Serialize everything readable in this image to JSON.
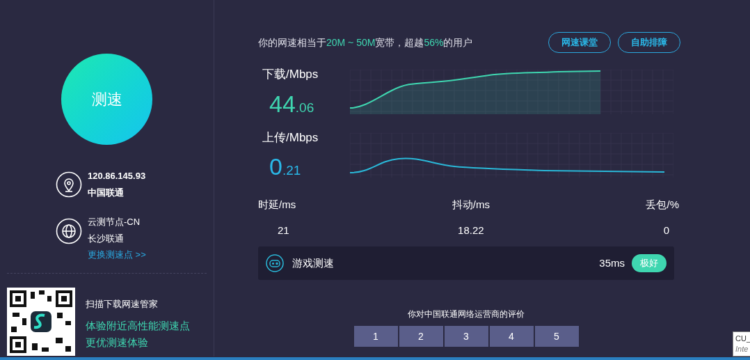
{
  "speed_button": {
    "label": "测速"
  },
  "connection": {
    "ip": "120.86.145.93",
    "isp": "中国联通"
  },
  "node": {
    "name": "云测节点-CN",
    "location": "长沙联通",
    "change_link": "更换测速点 >>"
  },
  "promo": {
    "title": "扫描下载网速管家",
    "lines": [
      "体验附近高性能测速点",
      "更优测速体验"
    ]
  },
  "summary": [
    {
      "text": "你的网速相当于",
      "highlight": false
    },
    {
      "text": "20M ~ 50M",
      "highlight": true
    },
    {
      "text": "宽带，超越",
      "highlight": false
    },
    {
      "text": "56%",
      "highlight": true
    },
    {
      "text": "的用户",
      "highlight": false
    }
  ],
  "header_buttons": [
    "网速课堂",
    "自助排障"
  ],
  "download": {
    "label": "下载/Mbps",
    "integer": "44",
    "decimal": ".06"
  },
  "upload": {
    "label": "上传/Mbps",
    "integer": "0",
    "decimal": ".21"
  },
  "metrics": [
    {
      "label": "时延/ms",
      "value": "21"
    },
    {
      "label": "抖动/ms",
      "value": "18.22"
    },
    {
      "label": "丢包/%",
      "value": "0"
    }
  ],
  "game_test": {
    "label": "游戏测速",
    "latency": "35ms",
    "rating": "极好"
  },
  "feedback": {
    "question": "你对中国联通网络运营商的评价",
    "options": [
      "1",
      "2",
      "3",
      "4",
      "5"
    ]
  },
  "tooltip": {
    "lines": [
      "CU_",
      "Inte"
    ]
  }
}
